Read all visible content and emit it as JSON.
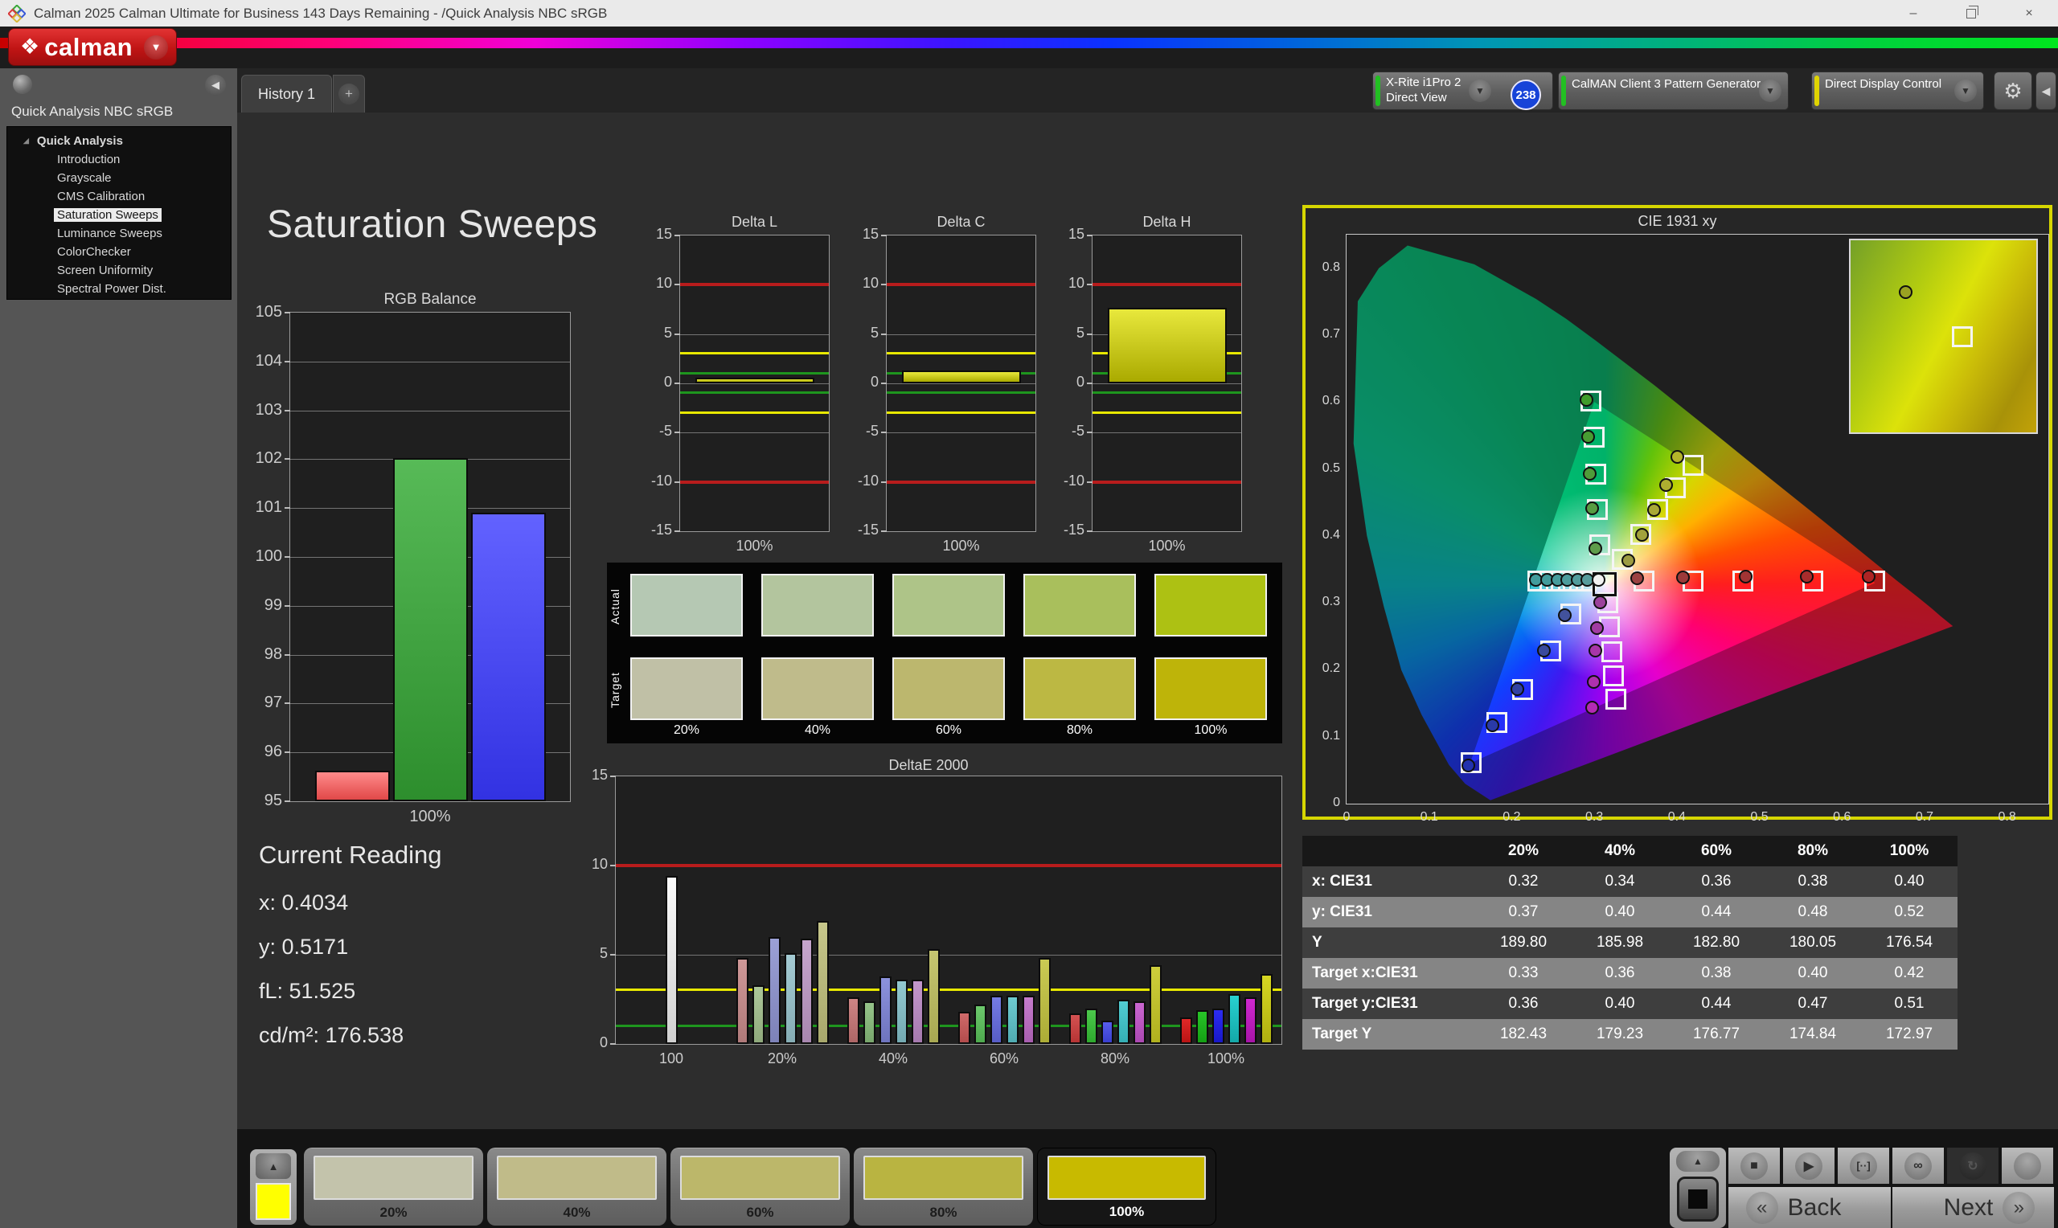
{
  "titlebar": {
    "title": "Calman 2025 Calman Ultimate for Business 143 Days Remaining  - /Quick Analysis NBC sRGB",
    "minimize": "–",
    "close": "×"
  },
  "brand": {
    "logo_glyph": "❖",
    "logo_text": "calman",
    "dropdown_glyph": "▼"
  },
  "toolbar": {
    "tab_label": "History 1",
    "add_tab_label": "+",
    "meter_dropdown": {
      "line1": "X-Rite i1Pro 2",
      "line2": "Direct View",
      "badge": "238",
      "accent": "#22c022"
    },
    "generator_dropdown": {
      "label": "CalMAN Client 3 Pattern Generator",
      "accent": "#22c022"
    },
    "display_dropdown": {
      "label": "Direct Display Control",
      "accent": "#e0d400"
    },
    "gear_glyph": "⚙",
    "collapse_glyph": "◀",
    "arrow_glyph": "▼"
  },
  "sidebar": {
    "header": "Quick Analysis NBC sRGB",
    "root_label": "Quick Analysis",
    "expander_glyph": "◢",
    "items": [
      "Introduction",
      "Grayscale",
      "CMS Calibration",
      "Saturation Sweeps",
      "Luminance Sweeps",
      "ColorChecker",
      "Screen Uniformity",
      "Spectral Power Dist."
    ],
    "selected_item": "Saturation Sweeps"
  },
  "page": {
    "title": "Saturation Sweeps"
  },
  "current_reading": {
    "heading": "Current Reading",
    "lines": [
      "x: 0.4034",
      "y: 0.5171",
      "fL: 51.525",
      "cd/m²: 176.538"
    ]
  },
  "chart_data": [
    {
      "id": "rgb",
      "type": "bar",
      "title": "RGB Balance",
      "ylim": [
        95,
        105
      ],
      "baseline": 95,
      "yticks": [
        95,
        96,
        97,
        98,
        99,
        100,
        101,
        102,
        103,
        104,
        105
      ],
      "reflines": [],
      "categories": [
        "Red",
        "Green",
        "Blue"
      ],
      "groups": [
        {
          "label": "100%",
          "values": [
            95.63,
            102.02,
            100.9
          ],
          "colors": [
            [
              "#ff8a8a",
              "#e04848"
            ],
            [
              "#57ba57",
              "#2d8e2d"
            ],
            [
              "#6262ff",
              "#3232e2"
            ]
          ]
        }
      ],
      "barW": 93,
      "gap": 4
    },
    {
      "id": "deltaL",
      "type": "bar",
      "title": "Delta L",
      "ylim": [
        -15,
        15
      ],
      "baseline": 0,
      "yticks": [
        -15,
        -10,
        -5,
        0,
        5,
        10,
        15
      ],
      "reflines": [
        {
          "v": 10,
          "c": "#b81c1c"
        },
        {
          "v": -10,
          "c": "#b81c1c"
        },
        {
          "v": 3,
          "c": "#e8e800"
        },
        {
          "v": -3,
          "c": "#e8e800"
        },
        {
          "v": 1,
          "c": "#1e961e"
        },
        {
          "v": -1,
          "c": "#1e961e"
        }
      ],
      "groups": [
        {
          "label": "100%",
          "values": [
            0.55
          ],
          "colors": [
            [
              "#e8e83c",
              "#aaaa00"
            ]
          ]
        }
      ],
      "barW": 148,
      "gap": 0
    },
    {
      "id": "deltaC",
      "type": "bar",
      "title": "Delta C",
      "ylim": [
        -15,
        15
      ],
      "baseline": 0,
      "yticks": [
        -15,
        -10,
        -5,
        0,
        5,
        10,
        15
      ],
      "reflines": [
        {
          "v": 10,
          "c": "#b81c1c"
        },
        {
          "v": -10,
          "c": "#b81c1c"
        },
        {
          "v": 3,
          "c": "#e8e800"
        },
        {
          "v": -3,
          "c": "#e8e800"
        },
        {
          "v": 1,
          "c": "#1e961e"
        },
        {
          "v": -1,
          "c": "#1e961e"
        }
      ],
      "groups": [
        {
          "label": "100%",
          "values": [
            1.3
          ],
          "colors": [
            [
              "#e8e83c",
              "#aaaa00"
            ]
          ]
        }
      ],
      "barW": 148,
      "gap": 0
    },
    {
      "id": "deltaH",
      "type": "bar",
      "title": "Delta H",
      "ylim": [
        -15,
        15
      ],
      "baseline": 0,
      "yticks": [
        -15,
        -10,
        -5,
        0,
        5,
        10,
        15
      ],
      "reflines": [
        {
          "v": 10,
          "c": "#b81c1c"
        },
        {
          "v": -10,
          "c": "#b81c1c"
        },
        {
          "v": 3,
          "c": "#e8e800"
        },
        {
          "v": -3,
          "c": "#e8e800"
        },
        {
          "v": 1,
          "c": "#1e961e"
        },
        {
          "v": -1,
          "c": "#1e961e"
        }
      ],
      "groups": [
        {
          "label": "100%",
          "values": [
            7.7
          ],
          "colors": [
            [
              "#e8e83c",
              "#aaaa00"
            ]
          ]
        }
      ],
      "barW": 148,
      "gap": 0
    },
    {
      "id": "deltaE",
      "type": "bar",
      "title": "DeltaE 2000",
      "ylim": [
        0,
        15
      ],
      "baseline": 0,
      "yticks": [
        0,
        5,
        10,
        15
      ],
      "reflines": [
        {
          "v": 10,
          "c": "#b81c1c"
        },
        {
          "v": 3,
          "c": "#e8e800"
        },
        {
          "v": 1,
          "c": "#1e961e"
        }
      ],
      "groups": [
        {
          "label": "100",
          "values": [
            9.4
          ],
          "colors": [
            [
              "#fafafa",
              "#d0d0d0"
            ]
          ]
        },
        {
          "label": "20%",
          "values": [
            4.8,
            3.3,
            6.0,
            5.1,
            5.9,
            6.9
          ],
          "colors": [
            [
              "#cf9898",
              "#b07a7a"
            ],
            [
              "#adc79a",
              "#8fa97c"
            ],
            [
              "#9ba0d6",
              "#7d82b8"
            ],
            [
              "#a4cbd3",
              "#86adb5"
            ],
            [
              "#c6a5cd",
              "#a887af"
            ],
            [
              "#c6c68a",
              "#a8a86c"
            ]
          ]
        },
        {
          "label": "40%",
          "values": [
            2.6,
            2.4,
            3.8,
            3.6,
            3.6,
            5.3
          ],
          "colors": [
            [
              "#cc8484",
              "#ae6666"
            ],
            [
              "#96c48a",
              "#78a66c"
            ],
            [
              "#8c92dc",
              "#6e74be"
            ],
            [
              "#92c8d0",
              "#74aab2"
            ],
            [
              "#c397cc",
              "#a579ae"
            ],
            [
              "#c6c670",
              "#a8a852"
            ]
          ]
        },
        {
          "label": "60%",
          "values": [
            1.8,
            2.2,
            2.7,
            2.7,
            2.7,
            4.8
          ],
          "colors": [
            [
              "#d06a6a",
              "#b24c4c"
            ],
            [
              "#6cc86c",
              "#4eaa4e"
            ],
            [
              "#757be4",
              "#575dc6"
            ],
            [
              "#6ecad0",
              "#50acb2"
            ],
            [
              "#c67ccd",
              "#a85eaf"
            ],
            [
              "#caca54",
              "#acac36"
            ]
          ]
        },
        {
          "label": "80%",
          "values": [
            1.7,
            2.0,
            1.3,
            2.5,
            2.4,
            4.4
          ],
          "colors": [
            [
              "#d45252",
              "#b63434"
            ],
            [
              "#4cc84c",
              "#2eaa2e"
            ],
            [
              "#575dec",
              "#393fce"
            ],
            [
              "#52ccd2",
              "#34aeb4"
            ],
            [
              "#ca66d0",
              "#ac48b2"
            ],
            [
              "#cece3c",
              "#b0b01e"
            ]
          ]
        },
        {
          "label": "100%",
          "values": [
            1.5,
            1.9,
            2.0,
            2.8,
            2.6,
            3.9
          ],
          "colors": [
            [
              "#e02828",
              "#b81414"
            ],
            [
              "#28c428",
              "#14a014"
            ],
            [
              "#2c2cf2",
              "#1818c8"
            ],
            [
              "#28d0d0",
              "#14a8a8"
            ],
            [
              "#d028d0",
              "#a814a8"
            ],
            [
              "#d6d622",
              "#b0b010"
            ]
          ]
        }
      ],
      "barW": 15,
      "gap": 5
    },
    {
      "id": "cie",
      "type": "scatter",
      "title": "CIE 1931 xy",
      "xlim": [
        0,
        0.85
      ],
      "ylim": [
        0,
        0.85
      ],
      "xticks": [
        0,
        0.1,
        0.2,
        0.3,
        0.4,
        0.5,
        0.6,
        0.7,
        0.8
      ],
      "yticks": [
        0,
        0.1,
        0.2,
        0.3,
        0.4,
        0.5,
        0.6,
        0.7,
        0.8
      ],
      "gamut_triangle": {
        "red": [
          0.64,
          0.33
        ],
        "green": [
          0.3,
          0.6
        ],
        "blue": [
          0.15,
          0.06
        ]
      },
      "white_point_target": [
        0.3127,
        0.328
      ],
      "white_point_measured": [
        0.306,
        0.334
      ],
      "target_squares": [
        [
          0.36,
          0.332
        ],
        [
          0.42,
          0.332
        ],
        [
          0.48,
          0.332
        ],
        [
          0.565,
          0.332
        ],
        [
          0.64,
          0.332
        ],
        [
          0.307,
          0.386
        ],
        [
          0.304,
          0.44
        ],
        [
          0.302,
          0.492
        ],
        [
          0.3,
          0.547
        ],
        [
          0.296,
          0.602
        ],
        [
          0.334,
          0.365
        ],
        [
          0.356,
          0.402
        ],
        [
          0.377,
          0.44
        ],
        [
          0.398,
          0.472
        ],
        [
          0.42,
          0.506
        ],
        [
          0.272,
          0.283
        ],
        [
          0.247,
          0.228
        ],
        [
          0.213,
          0.171
        ],
        [
          0.182,
          0.121
        ],
        [
          0.151,
          0.061
        ],
        [
          0.316,
          0.3
        ],
        [
          0.318,
          0.264
        ],
        [
          0.321,
          0.227
        ],
        [
          0.323,
          0.191
        ],
        [
          0.326,
          0.156
        ],
        [
          0.29,
          0.332
        ],
        [
          0.275,
          0.332
        ],
        [
          0.26,
          0.332
        ],
        [
          0.246,
          0.332
        ],
        [
          0.232,
          0.332
        ]
      ],
      "measured_circles": [
        [
          0.352,
          0.336,
          "#9c4242"
        ],
        [
          0.408,
          0.337,
          "#9c3a3a"
        ],
        [
          0.484,
          0.338,
          "#a23434"
        ],
        [
          0.558,
          0.338,
          "#a82c2c"
        ],
        [
          0.633,
          0.338,
          "#ae2424"
        ],
        [
          0.302,
          0.381,
          "#5f9c4a"
        ],
        [
          0.298,
          0.441,
          "#579c42"
        ],
        [
          0.295,
          0.492,
          "#4f9c3a"
        ],
        [
          0.293,
          0.547,
          "#479c32"
        ],
        [
          0.291,
          0.603,
          "#3f9c2a"
        ],
        [
          0.342,
          0.362,
          "#9c9c42"
        ],
        [
          0.358,
          0.401,
          "#a2a23c"
        ],
        [
          0.373,
          0.438,
          "#a8a836"
        ],
        [
          0.388,
          0.476,
          "#aeae30"
        ],
        [
          0.401,
          0.518,
          "#b4b42a"
        ],
        [
          0.265,
          0.281,
          "#42529c"
        ],
        [
          0.24,
          0.228,
          "#3a4a9c"
        ],
        [
          0.207,
          0.171,
          "#3242a2"
        ],
        [
          0.177,
          0.117,
          "#2a3aa8"
        ],
        [
          0.148,
          0.056,
          "#2232ae"
        ],
        [
          0.308,
          0.3,
          "#9c429c"
        ],
        [
          0.304,
          0.262,
          "#a23ca2"
        ],
        [
          0.302,
          0.228,
          "#a836a8"
        ],
        [
          0.3,
          0.181,
          "#ae30ae"
        ],
        [
          0.298,
          0.143,
          "#b42ab4"
        ],
        [
          0.23,
          0.334,
          "#429c9c"
        ],
        [
          0.243,
          0.334,
          "#429c9c"
        ],
        [
          0.256,
          0.334,
          "#479c9c"
        ],
        [
          0.268,
          0.334,
          "#4c9c9c"
        ],
        [
          0.28,
          0.334,
          "#529c9c"
        ],
        [
          0.292,
          0.334,
          "#579c9c"
        ],
        [
          0.306,
          0.334,
          "#f2f2f2"
        ]
      ],
      "inset": {
        "circle": [
          30,
          27,
          "#9aa222"
        ],
        "square": [
          60,
          50
        ]
      }
    }
  ],
  "swatch_grid": {
    "row_labels": [
      "Actual",
      "Target"
    ],
    "col_labels": [
      "20%",
      "40%",
      "60%",
      "80%",
      "100%"
    ],
    "actual_colors": [
      "#b5c8b3",
      "#b3c59e",
      "#aec488",
      "#a9bf5c",
      "#adc113"
    ],
    "target_colors": [
      "#c0c0a6",
      "#bfbb8b",
      "#bcb76e",
      "#bcb843",
      "#beb409"
    ]
  },
  "table": {
    "headers": [
      "",
      "20%",
      "40%",
      "60%",
      "80%",
      "100%"
    ],
    "rows": [
      [
        "x: CIE31",
        "0.32",
        "0.34",
        "0.36",
        "0.38",
        "0.40"
      ],
      [
        "y: CIE31",
        "0.37",
        "0.40",
        "0.44",
        "0.48",
        "0.52"
      ],
      [
        "Y",
        "189.80",
        "185.98",
        "182.80",
        "180.05",
        "176.54"
      ],
      [
        "Target x:CIE31",
        "0.33",
        "0.36",
        "0.38",
        "0.40",
        "0.42"
      ],
      [
        "Target y:CIE31",
        "0.36",
        "0.40",
        "0.44",
        "0.47",
        "0.51"
      ],
      [
        "Target Y",
        "182.43",
        "179.23",
        "176.77",
        "174.84",
        "172.97"
      ]
    ],
    "row_colors": [
      "#3e3e3e",
      "#858585",
      "#3e3e3e",
      "#858585",
      "#3e3e3e",
      "#858585"
    ]
  },
  "bottom_bar": {
    "up_glyph": "▲",
    "pattern_swatch_color": "#ffff00",
    "swatches": [
      {
        "label": "20%",
        "color": "#c3c3ab",
        "selected": false
      },
      {
        "label": "40%",
        "color": "#c0bb89",
        "selected": false
      },
      {
        "label": "60%",
        "color": "#bcb76a",
        "selected": false
      },
      {
        "label": "80%",
        "color": "#b9b441",
        "selected": false
      },
      {
        "label": "100%",
        "color": "#c8ba00",
        "selected": true
      }
    ],
    "transport": [
      {
        "name": "stop-button",
        "glyph": "■",
        "dark": false
      },
      {
        "name": "play-button",
        "glyph": "▶",
        "dark": false
      },
      {
        "name": "bracket-button",
        "glyph": "[··]",
        "dark": false
      },
      {
        "name": "loop-button",
        "glyph": "∞",
        "dark": false
      },
      {
        "name": "refresh-button",
        "glyph": "↻",
        "dark": true
      },
      {
        "name": "blank-button",
        "glyph": "",
        "dark": false
      }
    ],
    "back_label": "Back",
    "next_label": "Next",
    "back_chevron": "«",
    "next_chevron": "»"
  }
}
